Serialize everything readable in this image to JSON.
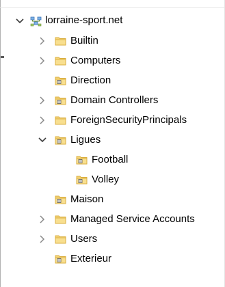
{
  "tree": {
    "root": {
      "label": "lorraine-sport.net",
      "expanded": true,
      "icon": "domain-icon"
    },
    "items": [
      {
        "label": "Builtin",
        "expandable": true,
        "expanded": false,
        "icon": "folder-icon"
      },
      {
        "label": "Computers",
        "expandable": true,
        "expanded": false,
        "icon": "folder-icon"
      },
      {
        "label": "Direction",
        "expandable": false,
        "expanded": false,
        "icon": "ou-icon"
      },
      {
        "label": "Domain Controllers",
        "expandable": true,
        "expanded": false,
        "icon": "ou-icon"
      },
      {
        "label": "ForeignSecurityPrincipals",
        "expandable": true,
        "expanded": false,
        "icon": "folder-icon"
      },
      {
        "label": "Ligues",
        "expandable": true,
        "expanded": true,
        "icon": "ou-icon",
        "children": [
          {
            "label": "Football",
            "icon": "ou-icon"
          },
          {
            "label": "Volley",
            "icon": "ou-icon"
          }
        ]
      },
      {
        "label": "Maison",
        "expandable": false,
        "expanded": false,
        "icon": "ou-icon"
      },
      {
        "label": "Managed Service Accounts",
        "expandable": true,
        "expanded": false,
        "icon": "folder-icon"
      },
      {
        "label": "Users",
        "expandable": true,
        "expanded": false,
        "icon": "folder-icon"
      },
      {
        "label": "Exterieur",
        "expandable": false,
        "expanded": false,
        "icon": "ou-icon"
      }
    ]
  },
  "colors": {
    "folder": "#f5d57a",
    "folder_edge": "#d9ad3c",
    "expander": "#8a8a8a",
    "expander_open": "#3c3c3c"
  }
}
